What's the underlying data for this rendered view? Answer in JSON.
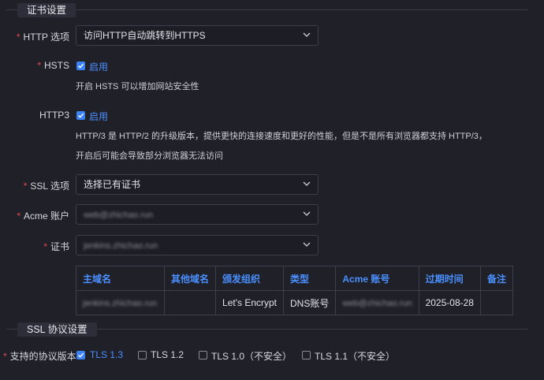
{
  "sections": {
    "cert_settings": "证书设置",
    "ssl_protocol": "SSL 协议设置"
  },
  "fields": {
    "http_option": {
      "label": "HTTP 选项",
      "value": "访问HTTP自动跳转到HTTPS"
    },
    "hsts": {
      "label": "HSTS",
      "checkbox_label": "启用",
      "help": "开启 HSTS 可以增加网站安全性"
    },
    "http3": {
      "label": "HTTP3",
      "checkbox_label": "启用",
      "help_line1": "HTTP/3 是 HTTP/2 的升级版本，提供更快的连接速度和更好的性能，但是不是所有浏览器都支持 HTTP/3，",
      "help_line2": "开启后可能会导致部分浏览器无法访问"
    },
    "ssl_option": {
      "label": "SSL 选项",
      "value": "选择已有证书"
    },
    "acme_account": {
      "label": "Acme 账户",
      "value": "web@zhichao.run"
    },
    "certificate": {
      "label": "证书",
      "value": "jenkins.zhichao.run"
    }
  },
  "cert_table": {
    "headers": [
      "主域名",
      "其他域名",
      "颁发组织",
      "类型",
      "Acme 账号",
      "过期时间",
      "备注"
    ],
    "row": [
      "jenkins.zhichao.run",
      "",
      "Let's Encrypt",
      "DNS账号",
      "web@zhichao.run",
      "2025-08-28",
      ""
    ]
  },
  "protocols": {
    "label": "支持的协议版本",
    "options": [
      {
        "label": "TLS 1.3",
        "checked": true
      },
      {
        "label": "TLS 1.2",
        "checked": false
      },
      {
        "label": "TLS 1.0（不安全）",
        "checked": false
      },
      {
        "label": "TLS 1.1（不安全）",
        "checked": false
      }
    ]
  },
  "colors": {
    "accent": "#3b82f6",
    "required": "#e5484d",
    "background": "#202029"
  }
}
